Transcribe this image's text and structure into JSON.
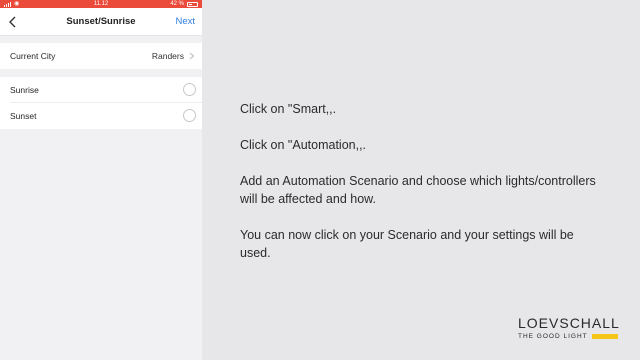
{
  "statusbar": {
    "time": "11.12",
    "battery": "42 %"
  },
  "navbar": {
    "title": "Sunset/Sunrise",
    "next_label": "Next"
  },
  "city_row": {
    "label": "Current City",
    "value": "Randers"
  },
  "options": [
    {
      "label": "Sunrise",
      "selected": false
    },
    {
      "label": "Sunset",
      "selected": false
    }
  ],
  "instructions": [
    "Click on \"Smart,,.",
    "Click on \"Automation,,.",
    "Add an Automation Scenario and choose which lights/controllers will be affected and how.",
    "You can now click on your Scenario and your settings will be used."
  ],
  "logo": {
    "name": "LOEVSCHALL",
    "tagline": "THE GOOD LIGHT"
  },
  "colors": {
    "statusbar": "#ea4b3b",
    "accent": "#2f7fe0",
    "logo_bar": "#f5c518"
  }
}
